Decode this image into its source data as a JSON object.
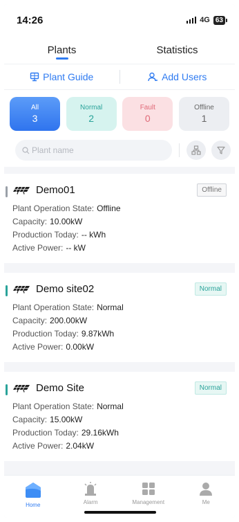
{
  "status_bar": {
    "time": "14:26",
    "network": "4G",
    "battery": "63"
  },
  "top_tabs": [
    {
      "label": "Plants",
      "active": true
    },
    {
      "label": "Statistics",
      "active": false
    }
  ],
  "actions": {
    "plant_guide": "Plant Guide",
    "add_users": "Add Users"
  },
  "filters": [
    {
      "label": "All",
      "count": "3",
      "active": true
    },
    {
      "label": "Normal",
      "count": "2"
    },
    {
      "label": "Fault",
      "count": "0"
    },
    {
      "label": "Offline",
      "count": "1"
    }
  ],
  "search": {
    "placeholder": "Plant name"
  },
  "plants": [
    {
      "name": "Demo01",
      "status": "Offline",
      "status_color": "#9aa0a8",
      "state_label": "Plant Operation State:",
      "state_value": "Offline",
      "capacity_label": "Capacity:",
      "capacity_value": "10.00kW",
      "production_label": "Production Today:",
      "production_value": "-- kWh",
      "power_label": "Active Power:",
      "power_value": "-- kW"
    },
    {
      "name": "Demo site02",
      "status": "Normal",
      "status_color": "#2aa39a",
      "state_label": "Plant Operation State:",
      "state_value": "Normal",
      "capacity_label": "Capacity:",
      "capacity_value": "200.00kW",
      "production_label": "Production Today:",
      "production_value": "9.87kWh",
      "power_label": "Active Power:",
      "power_value": "0.00kW"
    },
    {
      "name": "Demo Site",
      "status": "Normal",
      "status_color": "#2aa39a",
      "state_label": "Plant Operation State:",
      "state_value": "Normal",
      "capacity_label": "Capacity:",
      "capacity_value": "15.00kW",
      "production_label": "Production Today:",
      "production_value": "29.16kWh",
      "power_label": "Active Power:",
      "power_value": "2.04kW"
    }
  ],
  "bottom_nav": [
    {
      "label": "Home",
      "icon": "home-icon",
      "active": true
    },
    {
      "label": "Alarm",
      "icon": "alarm-icon"
    },
    {
      "label": "Management",
      "icon": "management-icon"
    },
    {
      "label": "Me",
      "icon": "profile-icon"
    }
  ],
  "colors": {
    "accent": "#2f7bf1",
    "normal": "#2aa39a",
    "fault": "#e06a78"
  }
}
